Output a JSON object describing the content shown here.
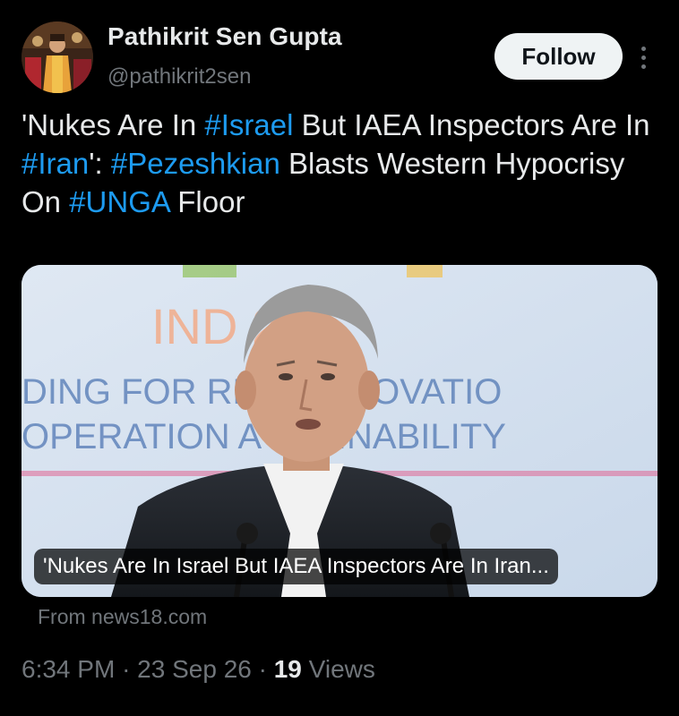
{
  "author": {
    "name": "Pathikrit Sen Gupta",
    "handle": "@pathikrit2sen"
  },
  "follow_label": "Follow",
  "tweet": {
    "segments": [
      {
        "text": "'Nukes Are In ",
        "hashtag": false
      },
      {
        "text": "#Israel",
        "hashtag": true
      },
      {
        "text": " But IAEA Inspectors Are In ",
        "hashtag": false
      },
      {
        "text": "#Iran",
        "hashtag": true
      },
      {
        "text": "': ",
        "hashtag": false
      },
      {
        "text": "#Pezeshkian",
        "hashtag": true
      },
      {
        "text": " Blasts Western Hypocrisy On ",
        "hashtag": false
      },
      {
        "text": "#UNGA",
        "hashtag": true
      },
      {
        "text": " Floor",
        "hashtag": false
      }
    ]
  },
  "card": {
    "caption": "'Nukes Are In Israel But IAEA Inspectors Are In Iran...",
    "source": "From news18.com",
    "backdrop_text": {
      "line1": "IND        26",
      "line2": "DING FOR RE      E, INNOVATIO",
      "line3": "OPERATION A      STAINABILITY"
    }
  },
  "meta": {
    "time": "6:34 PM",
    "separator": "·",
    "date": "23 Sep 26",
    "views_count": "19",
    "views_label": "Views"
  },
  "colors": {
    "background": "#000000",
    "text": "#e7e9ea",
    "muted": "#71767b",
    "hashtag": "#1d9bf0",
    "follow_bg": "#eff3f4"
  }
}
